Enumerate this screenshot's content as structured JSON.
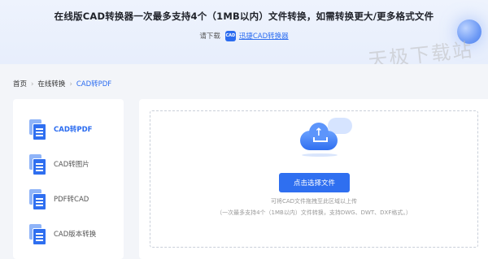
{
  "banner": {
    "title": "在线版CAD转换器一次最多支持4个（1MB以内）文件转换，如需转换更大/更多格式文件",
    "download_prefix": "请下载",
    "download_app_icon": "CAD",
    "download_link": "迅捷CAD转换器"
  },
  "watermark": "天极下载站",
  "breadcrumb": {
    "items": [
      "首页",
      "在线转换",
      "CAD转PDF"
    ],
    "separator": "›"
  },
  "sidebar": {
    "items": [
      {
        "label": "CAD转PDF",
        "icon": "cad-to-pdf-icon",
        "active": true
      },
      {
        "label": "CAD转图片",
        "icon": "cad-to-image-icon",
        "active": false
      },
      {
        "label": "PDF转CAD",
        "icon": "pdf-to-cad-icon",
        "active": false
      },
      {
        "label": "CAD版本转换",
        "icon": "cad-version-icon",
        "active": false
      }
    ]
  },
  "upload": {
    "icon": "cloud-upload-icon",
    "button_label": "点击选择文件",
    "hint_line1": "可将CAD文件拖拽至此区域以上传",
    "hint_line2": "（一次最多支持4个（1MB以内）文件转换，支持DWG、DWT、DXF格式。）"
  },
  "colors": {
    "accent": "#2f6ff0",
    "link": "#2b6cf0",
    "background": "#f3f5f9",
    "banner_bg": "#e9effc"
  }
}
